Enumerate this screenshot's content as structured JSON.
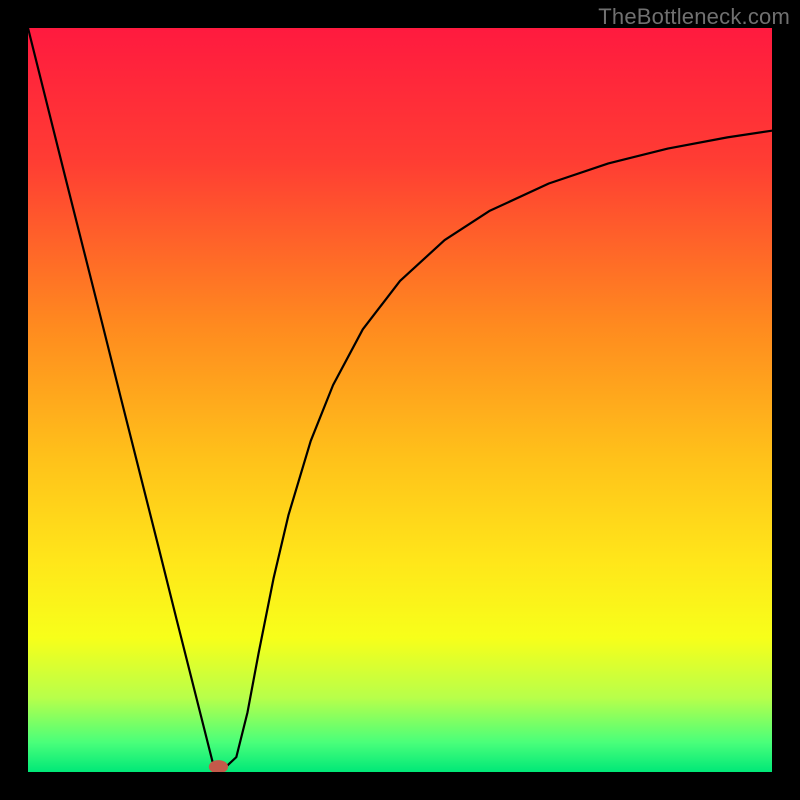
{
  "watermark": "TheBottleneck.com",
  "chart_data": {
    "type": "line",
    "title": "",
    "xlabel": "",
    "ylabel": "",
    "xlim": [
      0,
      100
    ],
    "ylim": [
      0,
      100
    ],
    "grid": false,
    "legend": false,
    "background_gradient": {
      "stops": [
        {
          "pos": 0.0,
          "color": "#ff1a3f"
        },
        {
          "pos": 0.18,
          "color": "#ff3d33"
        },
        {
          "pos": 0.4,
          "color": "#ff8a1f"
        },
        {
          "pos": 0.58,
          "color": "#ffc21a"
        },
        {
          "pos": 0.72,
          "color": "#ffe71a"
        },
        {
          "pos": 0.82,
          "color": "#f7ff1a"
        },
        {
          "pos": 0.9,
          "color": "#b8ff4a"
        },
        {
          "pos": 0.96,
          "color": "#4aff7a"
        },
        {
          "pos": 1.0,
          "color": "#00e878"
        }
      ]
    },
    "series": [
      {
        "name": "bottleneck-curve",
        "stroke": "#000000",
        "stroke_width": 2.2,
        "x": [
          0.0,
          2.5,
          5.0,
          7.5,
          10.0,
          12.5,
          15.0,
          17.5,
          20.0,
          22.5,
          25.0,
          26.5,
          28.0,
          29.5,
          31.0,
          33.0,
          35.0,
          38.0,
          41.0,
          45.0,
          50.0,
          56.0,
          62.0,
          70.0,
          78.0,
          86.0,
          94.0,
          100.0
        ],
        "y": [
          100.0,
          90.0,
          80.0,
          70.1,
          60.2,
          50.2,
          40.3,
          30.4,
          20.4,
          10.5,
          0.6,
          0.6,
          2.0,
          8.0,
          16.0,
          26.0,
          34.5,
          44.5,
          52.0,
          59.5,
          66.0,
          71.5,
          75.4,
          79.1,
          81.8,
          83.8,
          85.3,
          86.2
        ]
      }
    ],
    "marker": {
      "name": "optimal-point",
      "x": 25.6,
      "y": 0.7,
      "rx": 1.3,
      "ry": 0.9,
      "fill": "#c45a4a"
    }
  }
}
